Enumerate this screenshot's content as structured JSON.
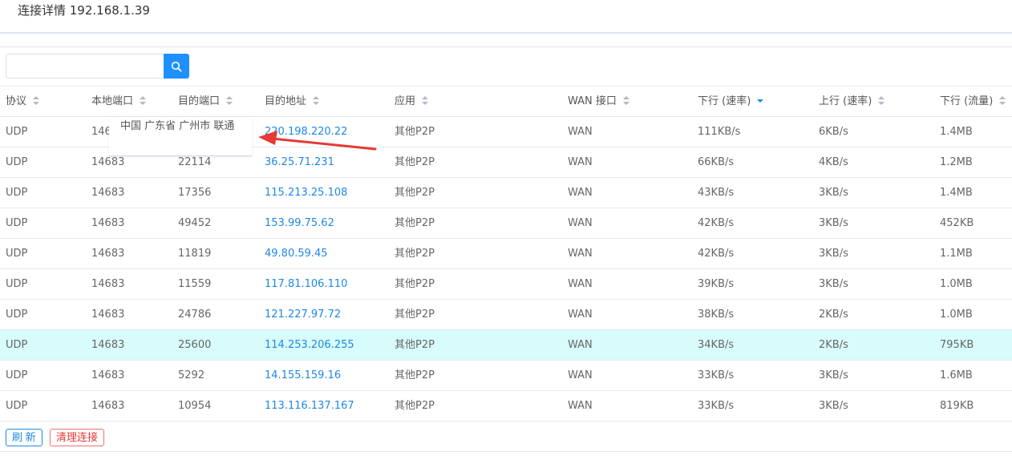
{
  "title": "连接详情 192.168.1.39",
  "search": {
    "value": "",
    "placeholder": ""
  },
  "columns": [
    "协议",
    "本地端口",
    "目的端口",
    "目的地址",
    "应用",
    "WAN 接口",
    "下行 (速率)",
    "上行 (速率)",
    "下行 (流量)"
  ],
  "active_sort_column": "下行 (速率)",
  "active_sort_direction": "descending",
  "rows": [
    [
      "UDP",
      "146",
      "",
      "220.198.220.22",
      "其他P2P",
      "WAN",
      "111KB/s",
      "6KB/s",
      "1.4MB"
    ],
    [
      "UDP",
      "14683",
      "22114",
      "36.25.71.231",
      "其他P2P",
      "WAN",
      "66KB/s",
      "4KB/s",
      "1.2MB"
    ],
    [
      "UDP",
      "14683",
      "17356",
      "115.213.25.108",
      "其他P2P",
      "WAN",
      "43KB/s",
      "3KB/s",
      "1.4MB"
    ],
    [
      "UDP",
      "14683",
      "49452",
      "153.99.75.62",
      "其他P2P",
      "WAN",
      "42KB/s",
      "3KB/s",
      "452KB"
    ],
    [
      "UDP",
      "14683",
      "11819",
      "49.80.59.45",
      "其他P2P",
      "WAN",
      "42KB/s",
      "3KB/s",
      "1.1MB"
    ],
    [
      "UDP",
      "14683",
      "11559",
      "117.81.106.110",
      "其他P2P",
      "WAN",
      "39KB/s",
      "3KB/s",
      "1.0MB"
    ],
    [
      "UDP",
      "14683",
      "24786",
      "121.227.97.72",
      "其他P2P",
      "WAN",
      "38KB/s",
      "2KB/s",
      "1.0MB"
    ],
    [
      "UDP",
      "14683",
      "25600",
      "114.253.206.255",
      "其他P2P",
      "WAN",
      "34KB/s",
      "2KB/s",
      "795KB"
    ],
    [
      "UDP",
      "14683",
      "5292",
      "14.155.159.16",
      "其他P2P",
      "WAN",
      "33KB/s",
      "3KB/s",
      "1.6MB"
    ],
    [
      "UDP",
      "14683",
      "10954",
      "113.116.137.167",
      "其他P2P",
      "WAN",
      "33KB/s",
      "3KB/s",
      "819KB"
    ]
  ],
  "highlighted_row": 8,
  "tooltip": {
    "text": "中国 广东省 广州市 联通"
  },
  "buttons": {
    "refresh": "刷 新",
    "clear": "清理连接"
  },
  "colors": {
    "accent": "#1e88e5",
    "danger": "#e53935",
    "highlight_row": "#d8fbfb",
    "annotation_arrow": "#e53935"
  }
}
